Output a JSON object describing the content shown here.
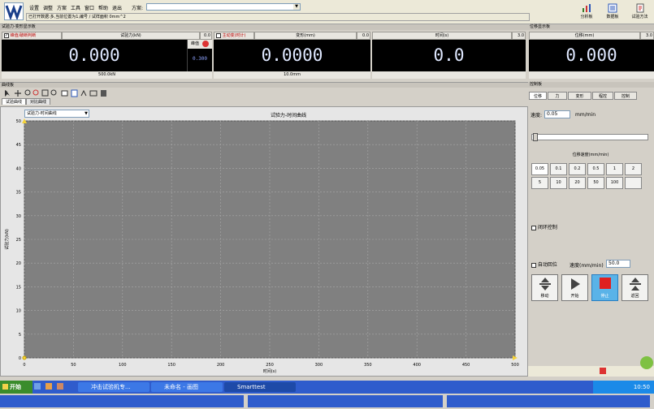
{
  "menu": [
    "设置",
    "调整",
    "方案",
    "工具",
    "窗口",
    "帮助",
    "退出"
  ],
  "scheme_label": "方案:",
  "status_line": "已打开数据:多,当前位置为1,编号 / 试样面积 0mm^2",
  "toolbar_buttons": [
    "分析板",
    "数据板",
    "试验方法"
  ],
  "display_section_title": "试验力-变形显示板",
  "position_section_title": "位移显示板",
  "force": {
    "checkbox_label": "峰值/破断判断",
    "header": "试验力(kN)",
    "header_val": "0.0",
    "value": "0.000",
    "peak_label": "峰值",
    "peak_value": "0.300",
    "range": "500.0kN"
  },
  "deform": {
    "checkbox_label": "主动变(时计)",
    "header": "变形(mm)",
    "header_val": "0.0",
    "value": "0.0000",
    "range": "10.0mm"
  },
  "time": {
    "header": "时间(s)",
    "header_val": "3.0",
    "value": "0.0"
  },
  "position": {
    "header": "位移(mm)",
    "header_val": "3.0",
    "value": "0.000"
  },
  "curve": {
    "panel_title": "曲线板",
    "tabs": [
      "试验曲线",
      "对比曲线"
    ],
    "selector": "试验力-时间曲线",
    "title": "试验力-时间曲线"
  },
  "chart_data": {
    "type": "line",
    "title": "试验力-时间曲线",
    "xlabel": "时间(s)",
    "ylabel": "试验力(kN)",
    "xlim": [
      0,
      500
    ],
    "ylim": [
      0,
      50
    ],
    "xticks": [
      "0",
      "50",
      "100",
      "150",
      "200",
      "250",
      "300",
      "350",
      "400",
      "450",
      "500"
    ],
    "yticks": [
      "0",
      "5",
      "10",
      "15",
      "20",
      "25",
      "30",
      "35",
      "40",
      "45",
      "50"
    ],
    "grid": true,
    "series": [
      {
        "x": [
          0
        ],
        "y": [
          0
        ]
      }
    ]
  },
  "control": {
    "title": "控制板",
    "tabs": [
      "位移",
      "力",
      "变形",
      "程控",
      "控制"
    ],
    "speed_label": "速度:",
    "speed_value": "0.05",
    "speed_unit": "mm/min",
    "rate_title": "位移速度(mm/min)",
    "rate_buttons": [
      "0.05",
      "0.1",
      "0.2",
      "0.5",
      "1",
      "2",
      "5",
      "10",
      "20",
      "50",
      "100",
      ""
    ],
    "closed_loop_label": "闭环控制",
    "auto_return_label": "自动回位",
    "return_speed_label": "速度(mm/min)",
    "return_speed_value": "50.0",
    "actions": [
      "移动",
      "开始",
      "停止",
      "返回"
    ]
  },
  "taskbar": {
    "start": "开始",
    "tasks": [
      "冲击试验机专...",
      "未命名 - 画图",
      "Smarttest"
    ],
    "clock": "10:50"
  }
}
